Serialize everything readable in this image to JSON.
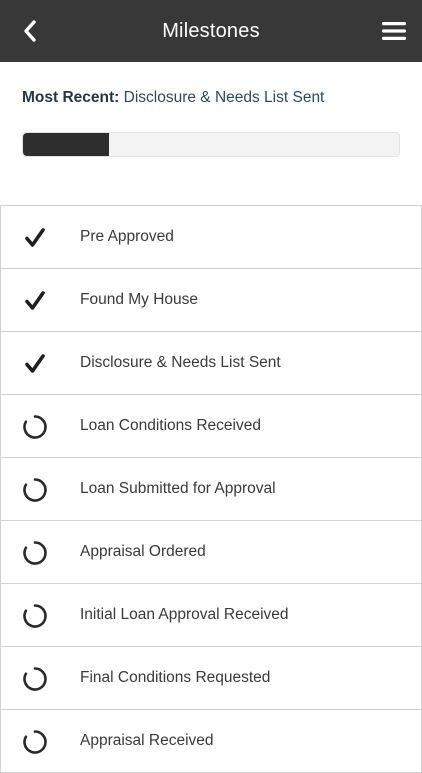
{
  "header": {
    "title": "Milestones",
    "back_icon": "chevron-left-icon",
    "menu_icon": "hamburger-menu-icon"
  },
  "most_recent": {
    "label": "Most Recent:",
    "value": "Disclosure & Needs List Sent"
  },
  "progress": {
    "fraction": 0.23
  },
  "colors": {
    "navbar": "#383838",
    "progress_fill": "#2e2e2e",
    "accent_text": "#2e4a5e"
  },
  "milestones": [
    {
      "label": "Pre Approved",
      "status": "complete",
      "icon": "checkmark-icon"
    },
    {
      "label": "Found My House",
      "status": "complete",
      "icon": "checkmark-icon"
    },
    {
      "label": "Disclosure & Needs List Sent",
      "status": "complete",
      "icon": "checkmark-icon"
    },
    {
      "label": "Loan Conditions Received",
      "status": "pending",
      "icon": "pending-spinner-icon"
    },
    {
      "label": "Loan Submitted for Approval",
      "status": "pending",
      "icon": "pending-spinner-icon"
    },
    {
      "label": "Appraisal Ordered",
      "status": "pending",
      "icon": "pending-spinner-icon"
    },
    {
      "label": "Initial Loan Approval Received",
      "status": "pending",
      "icon": "pending-spinner-icon"
    },
    {
      "label": "Final Conditions Requested",
      "status": "pending",
      "icon": "pending-spinner-icon"
    },
    {
      "label": "Appraisal Received",
      "status": "pending",
      "icon": "pending-spinner-icon"
    }
  ]
}
